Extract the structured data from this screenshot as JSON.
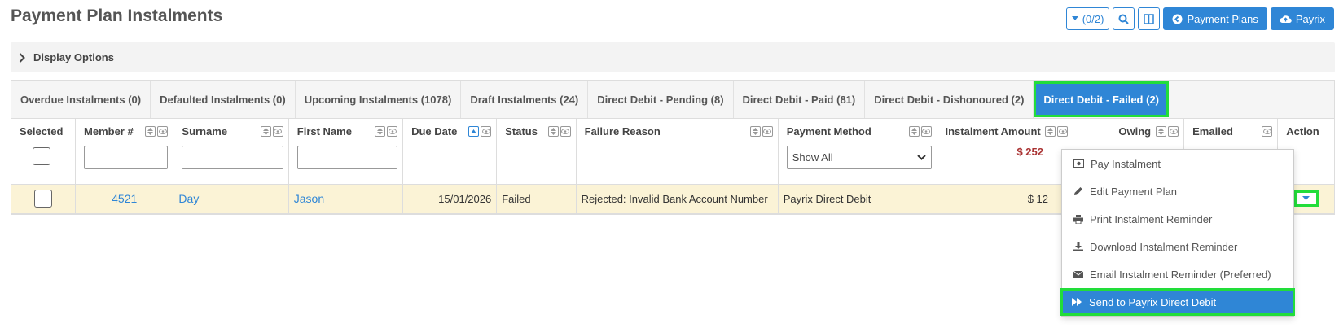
{
  "page": {
    "title": "Payment Plan Instalments"
  },
  "top_actions": {
    "filter_count": "(0/2)",
    "payment_plans": "Payment Plans",
    "payrix": "Payrix"
  },
  "display_options": {
    "label": "Display Options"
  },
  "tabs": [
    {
      "label": "Overdue Instalments (0)"
    },
    {
      "label": "Defaulted Instalments (0)"
    },
    {
      "label": "Upcoming Instalments (1078)"
    },
    {
      "label": "Draft Instalments (24)"
    },
    {
      "label": "Direct Debit - Pending (8)"
    },
    {
      "label": "Direct Debit - Paid (81)"
    },
    {
      "label": "Direct Debit - Dishonoured (2)"
    },
    {
      "label": "Direct Debit - Failed (2)"
    }
  ],
  "columns": {
    "selected": "Selected",
    "member": "Member #",
    "surname": "Surname",
    "first_name": "First Name",
    "due_date": "Due Date",
    "status": "Status",
    "failure_reason": "Failure Reason",
    "payment_method": "Payment Method",
    "instalment_amount": "Instalment Amount",
    "owing": "Owing",
    "emailed": "Emailed",
    "action": "Action"
  },
  "filters": {
    "payment_method": "Show All",
    "amount_total": "$ 252"
  },
  "rows": [
    {
      "member": "4521",
      "surname": "Day",
      "first_name": "Jason",
      "due_date": "15/01/2026",
      "status": "Failed",
      "failure_reason": "Rejected: Invalid Bank Account Number",
      "payment_method": "Payrix Direct Debit",
      "amount": "$ 12"
    }
  ],
  "menu": [
    {
      "label": "Pay Instalment",
      "icon": "money-icon"
    },
    {
      "label": "Edit Payment Plan",
      "icon": "pencil-icon"
    },
    {
      "label": "Print Instalment Reminder",
      "icon": "print-icon"
    },
    {
      "label": "Download Instalment Reminder",
      "icon": "download-icon"
    },
    {
      "label": "Email Instalment Reminder (Preferred)",
      "icon": "envelope-icon"
    },
    {
      "label": "Send to Payrix Direct Debit",
      "icon": "fast-forward-icon"
    }
  ],
  "colors": {
    "accent": "#2f86d6",
    "highlight": "#22dd3a",
    "row_bg": "#fbf3d6"
  }
}
